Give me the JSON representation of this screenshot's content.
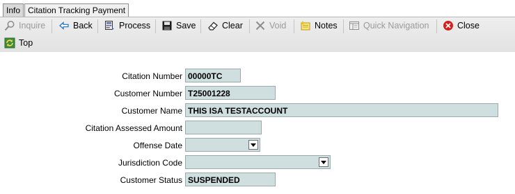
{
  "tabs": [
    {
      "label": "Info"
    },
    {
      "label": "Citation Tracking Payment"
    }
  ],
  "toolbar": {
    "inquire": "Inquire",
    "back": "Back",
    "process": "Process",
    "save": "Save",
    "clear": "Clear",
    "void": "Void",
    "notes": "Notes",
    "quick_navigation": "Quick Navigation",
    "close": "Close",
    "top": "Top"
  },
  "form": {
    "citation_number": {
      "label": "Citation Number",
      "value": "00000TC"
    },
    "customer_number": {
      "label": "Customer Number",
      "value": "T25001228"
    },
    "customer_name": {
      "label": "Customer Name",
      "value": "THIS ISA TESTACCOUNT"
    },
    "citation_assessed_amount": {
      "label": "Citation Assessed Amount",
      "value": ""
    },
    "offense_date": {
      "label": "Offense Date",
      "value": ""
    },
    "jurisdiction_code": {
      "label": "Jurisdiction Code",
      "value": ""
    },
    "customer_status": {
      "label": "Customer Status",
      "value": "SUSPENDED"
    }
  },
  "colors": {
    "field_bg": "#cfdede",
    "toolbar_bg": "#e8e8e8",
    "close_icon": "#d62020"
  },
  "icons": [
    "magnifier-icon",
    "back-arrow-icon",
    "calculator-icon",
    "floppy-disk-icon",
    "eraser-icon",
    "x-icon",
    "notes-icon",
    "quick-navigation-icon",
    "close-circle-icon",
    "refresh-top-icon"
  ]
}
